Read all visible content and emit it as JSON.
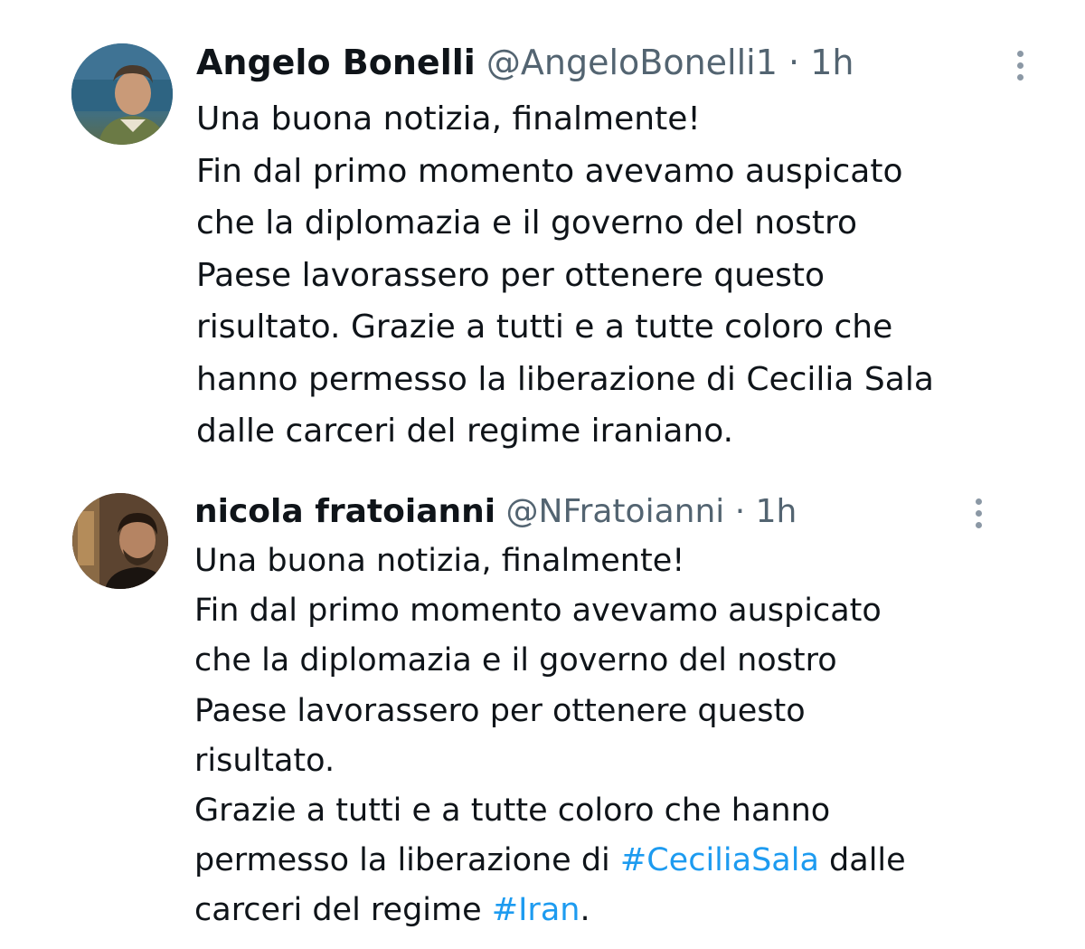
{
  "tweets": [
    {
      "display_name": "Angelo Bonelli",
      "handle": "@AngeloBonelli1",
      "separator": "·",
      "time": "1h",
      "lines": [
        "Una buona notizia, finalmente!",
        "Fin dal primo momento avevamo auspicato",
        "che la diplomazia e il governo del nostro",
        "Paese lavorassero per ottenere questo",
        "risultato. Grazie a tutti e a tutte coloro che",
        "hanno permesso la liberazione di Cecilia Sala",
        "dalle carceri del regime iraniano."
      ],
      "more_icon": "vertical-ellipsis-icon"
    },
    {
      "display_name": "nicola fratoianni",
      "handle": "@NFratoianni",
      "separator": "·",
      "time": "1h",
      "lines": [
        "Una buona notizia, finalmente!",
        "Fin dal primo momento avevamo auspicato",
        "che la diplomazia e il governo del nostro",
        "Paese lavorassero per ottenere questo",
        "risultato.",
        "Grazie a tutti e a tutte coloro che hanno"
      ],
      "line7": {
        "before": "permesso la liberazione di ",
        "hashtag": "#CeciliaSala",
        "after": " dalle"
      },
      "line8": {
        "before": "carceri del regime ",
        "hashtag": "#Iran",
        "after": "."
      },
      "more_icon": "vertical-ellipsis-icon"
    }
  ],
  "colors": {
    "text": "#0f1419",
    "secondary": "#536471",
    "hashtag": "#1d9bf0"
  }
}
